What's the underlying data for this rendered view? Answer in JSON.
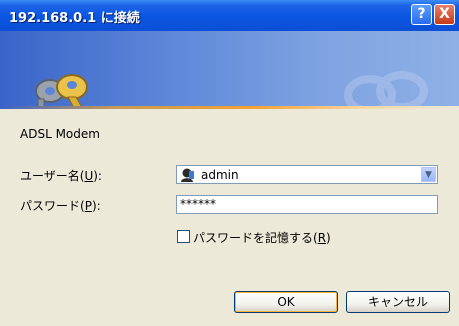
{
  "window": {
    "title": "192.168.0.1 に接続"
  },
  "titlebar": {
    "help_glyph": "?",
    "close_glyph": "X"
  },
  "banner": {
    "icon": "keys-icon",
    "watermark": "keys-watermark-icon"
  },
  "dialog": {
    "device_name": "ADSL Modem",
    "username_label_prefix": "ユーザー名(",
    "username_accel": "U",
    "username_label_suffix": "):",
    "username_value": "admin",
    "username_icon": "user-icon",
    "password_label_prefix": "パスワード(",
    "password_accel": "P",
    "password_label_suffix": "):",
    "password_value": "******",
    "remember_label_prefix": "パスワードを記憶する(",
    "remember_accel": "R",
    "remember_label_suffix": ")",
    "remember_checked": false
  },
  "buttons": {
    "ok": "OK",
    "cancel": "キャンセル"
  },
  "colors": {
    "titlebar": "#0a55e0",
    "dialog_bg": "#ece9d8",
    "banner": "#5b86d8",
    "accent_line": "#f2a233"
  }
}
